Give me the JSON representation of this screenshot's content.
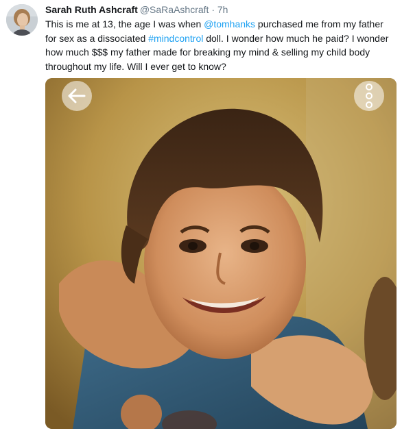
{
  "tweet": {
    "display_name": "Sarah Ruth Ashcraft",
    "handle": "@SaRaAshcraft",
    "separator": " · ",
    "time": "7h",
    "text_parts": {
      "p1": "This is me at 13, the age I was when ",
      "mention": "@tomhanks",
      "p2": " purchased me from my father for sex as a dissociated ",
      "hashtag": "#mindcontrol",
      "p3": " doll. I wonder how much he paid? I wonder how much $$$ my father made for breaking my mind & selling my child body throughout my life. Will I ever get to know?"
    }
  },
  "media": {
    "back_icon": "arrow-left-icon",
    "more_icon": "more-vertical-icon"
  },
  "colors": {
    "link": "#1da1f2",
    "muted": "#657786",
    "text": "#14171a"
  }
}
